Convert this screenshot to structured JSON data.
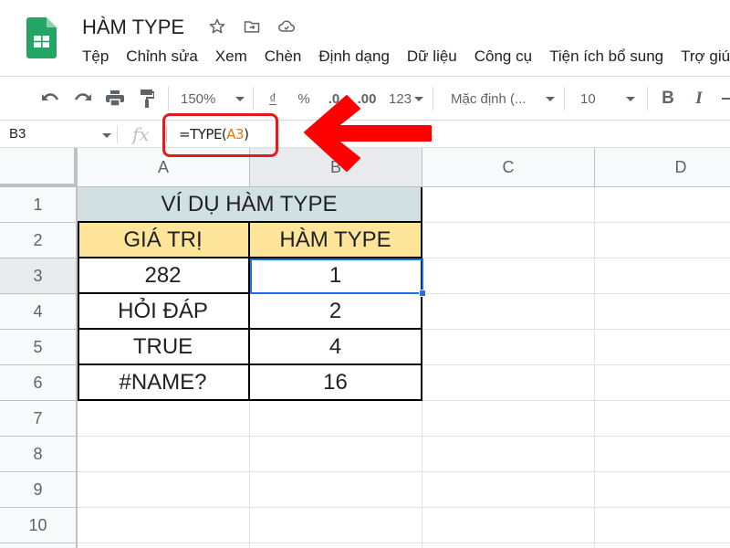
{
  "app": {
    "name": "Google Sheets",
    "brand_color": "#0f9d58"
  },
  "title_bar": {
    "document_title": "HÀM TYPE",
    "icons": [
      "star-icon",
      "move-to-folder-icon",
      "cloud-saved-icon"
    ]
  },
  "menu": {
    "items": [
      "Tệp",
      "Chỉnh sửa",
      "Xem",
      "Chèn",
      "Định dạng",
      "Dữ liệu",
      "Công cụ",
      "Tiện ích bổ sung",
      "Trợ giúp"
    ]
  },
  "toolbar": {
    "zoom": "150%",
    "currency_symbol": "₫",
    "percent_symbol": "%",
    "decrease_decimals": ".0",
    "increase_decimals": ".00",
    "more_formats": "123",
    "font_family": "Mặc định (...",
    "font_size": "10",
    "bold": "B",
    "italic": "I"
  },
  "formula_bar": {
    "name_box": "B3",
    "fx_label": "fx",
    "formula_prefix": "=TYPE(",
    "formula_ref": "A3",
    "formula_suffix": ")",
    "ref_color": "#e8710a"
  },
  "sheet": {
    "columns": [
      "A",
      "B",
      "C",
      "D"
    ],
    "rows": [
      "1",
      "2",
      "3",
      "4",
      "5",
      "6",
      "7",
      "8",
      "9",
      "10"
    ],
    "active_cell": "B3",
    "table": {
      "title": "VÍ DỤ HÀM TYPE",
      "headers": [
        "GIÁ TRỊ",
        "HÀM TYPE"
      ],
      "rows": [
        [
          "282",
          "1"
        ],
        [
          "HỎI ĐÁP",
          "2"
        ],
        [
          "TRUE",
          "4"
        ],
        [
          "#NAME?",
          "16"
        ]
      ],
      "title_fill": "#d0e0e3",
      "header_fill": "#ffe599"
    }
  },
  "annotation": {
    "color": "#ff0000",
    "highlights": "formula-bar"
  }
}
